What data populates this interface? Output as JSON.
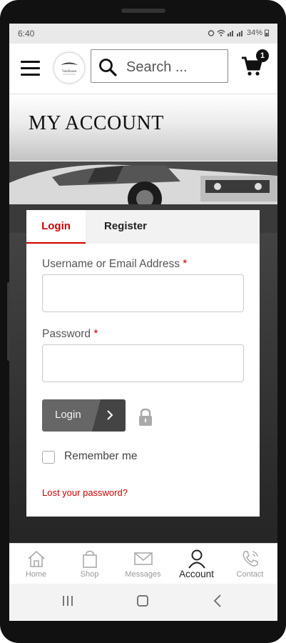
{
  "status_bar": {
    "time": "6:40",
    "battery": "34%"
  },
  "header": {
    "search_placeholder": "Search ...",
    "cart_count": "1",
    "logo_text": "VanHusen"
  },
  "hero": {
    "title": "MY ACCOUNT"
  },
  "tabs": {
    "login": "Login",
    "register": "Register"
  },
  "form": {
    "username_label": "Username or Email Address",
    "password_label": "Password",
    "required_mark": "*",
    "login_button": "Login",
    "remember_label": "Remember me",
    "lost_password": "Lost your password?"
  },
  "bottom_nav": [
    {
      "label": "Home",
      "icon": "home-icon"
    },
    {
      "label": "Shop",
      "icon": "shopping-bag-icon"
    },
    {
      "label": "Messages",
      "icon": "envelope-icon"
    },
    {
      "label": "Account",
      "icon": "user-icon"
    },
    {
      "label": "Contact",
      "icon": "phone-icon"
    }
  ],
  "colors": {
    "accent": "#cc0000",
    "button": "#666666",
    "button_dark": "#444444"
  }
}
